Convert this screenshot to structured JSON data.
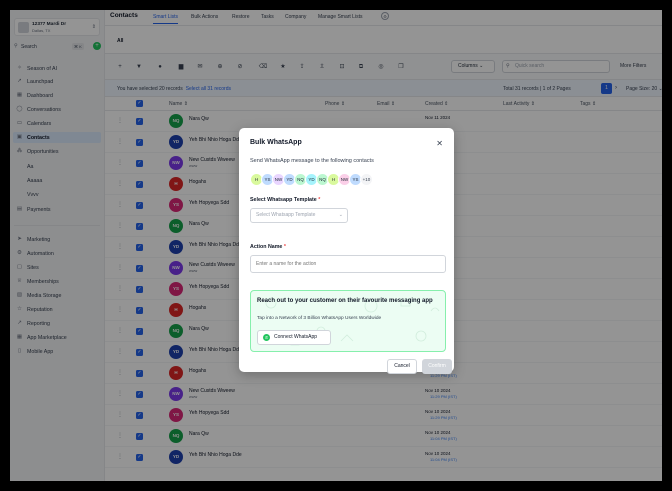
{
  "sidebar": {
    "account": {
      "name": "12377 Mardi Dr",
      "location": "Dallas, TX"
    },
    "search": {
      "label": "Search",
      "shortcut": "⌘ K"
    },
    "items": [
      {
        "label": "Season of AI",
        "icon": "sparkle-icon"
      },
      {
        "label": "Launchpad",
        "icon": "rocket-icon"
      },
      {
        "label": "Dashboard",
        "icon": "dashboard-icon"
      },
      {
        "label": "Conversations",
        "icon": "chat-icon"
      },
      {
        "label": "Calendars",
        "icon": "calendar-icon"
      },
      {
        "label": "Contacts",
        "icon": "contacts-icon"
      },
      {
        "label": "Opportunities",
        "icon": "opportunities-icon"
      },
      {
        "label": "Aa"
      },
      {
        "label": "Aaaaa"
      },
      {
        "label": "Vvvv"
      },
      {
        "label": "Payments",
        "icon": "payments-icon"
      },
      {
        "label": "Marketing",
        "icon": "marketing-icon"
      },
      {
        "label": "Automation",
        "icon": "automation-icon"
      },
      {
        "label": "Sites",
        "icon": "sites-icon"
      },
      {
        "label": "Memberships",
        "icon": "memberships-icon"
      },
      {
        "label": "Media Storage",
        "icon": "media-icon"
      },
      {
        "label": "Reputation",
        "icon": "star-icon"
      },
      {
        "label": "Reporting",
        "icon": "reporting-icon"
      },
      {
        "label": "App Marketplace",
        "icon": "marketplace-icon"
      },
      {
        "label": "Mobile App",
        "icon": "mobile-icon"
      }
    ]
  },
  "header": {
    "title": "Contacts",
    "tabs": [
      "Smart Lists",
      "Bulk Actions",
      "Restore",
      "Tasks",
      "Company",
      "Manage Smart Lists"
    ],
    "subtab": "All"
  },
  "toolbar": {
    "columns": "Columns",
    "search_placeholder": "Quick search",
    "more_filters": "More Filters"
  },
  "selection": {
    "text": "You have selected 20 records",
    "select_all": "Select all 31 records",
    "total": "Total 31 records | 1 of 2 Pages",
    "page": "1",
    "page_size": "Page Size: 20"
  },
  "table": {
    "headers": [
      "Name",
      "Phone",
      "Email",
      "Created",
      "Last Activity",
      "Tags"
    ],
    "rows": [
      {
        "initials": "NQ",
        "name": "Nara Qw",
        "color": "#16a34a",
        "created": "Nov 11 2024",
        "time": ""
      },
      {
        "initials": "YD",
        "name": "Yeh Bhi Nhio Hoga Dde",
        "color": "#1e40af",
        "created": "",
        "time": ""
      },
      {
        "initials": "NW",
        "name": "New Custds Wweew",
        "sub": "www",
        "color": "#7c3aed",
        "created": "",
        "time": ""
      },
      {
        "initials": "H",
        "name": "Hogahs",
        "color": "#dc2626",
        "created": "",
        "time": ""
      },
      {
        "initials": "YS",
        "name": "Yeh Hopyega Sdd",
        "color": "#db2777",
        "created": "",
        "time": ""
      },
      {
        "initials": "NQ",
        "name": "Nara Qw",
        "color": "#16a34a",
        "created": "",
        "time": ""
      },
      {
        "initials": "YD",
        "name": "Yeh Bhi Nhio Hoga Dde",
        "color": "#1e40af",
        "created": "",
        "time": ""
      },
      {
        "initials": "NW",
        "name": "New Custds Wweew",
        "sub": "www",
        "color": "#7c3aed",
        "created": "",
        "time": ""
      },
      {
        "initials": "YS",
        "name": "Yeh Hopyega Sdd",
        "color": "#db2777",
        "created": "",
        "time": ""
      },
      {
        "initials": "H",
        "name": "Hogahs",
        "color": "#dc2626",
        "created": "",
        "time": ""
      },
      {
        "initials": "NQ",
        "name": "Nara Qw",
        "color": "#16a34a",
        "created": "",
        "time": ""
      },
      {
        "initials": "YD",
        "name": "Yeh Bhi Nhio Hoga Dde",
        "color": "#1e40af",
        "created": "",
        "time": ""
      },
      {
        "initials": "H",
        "name": "Hogahs",
        "color": "#dc2626",
        "created": "Nov 10 2024",
        "time": "11:29 PM (IST)"
      },
      {
        "initials": "NW",
        "name": "New Custds Wweew",
        "sub": "www",
        "color": "#7c3aed",
        "created": "Nov 10 2024",
        "time": "11:29 PM (IST)"
      },
      {
        "initials": "YS",
        "name": "Yeh Hopyega Sdd",
        "color": "#db2777",
        "created": "Nov 10 2024",
        "time": "11:29 PM (IST)"
      },
      {
        "initials": "NQ",
        "name": "Nara Qw",
        "color": "#16a34a",
        "created": "Nov 10 2024",
        "time": "11:04 PM (IST)"
      },
      {
        "initials": "YD",
        "name": "Yeh Bhi Nhio Hoga Dde",
        "color": "#1e40af",
        "created": "Nov 10 2024",
        "time": "11:04 PM (IST)"
      }
    ]
  },
  "modal": {
    "title": "Bulk WhatsApp",
    "description": "Send WhatsApp message to the following contacts",
    "avatars": [
      {
        "initials": "H",
        "color": "#d9f99d"
      },
      {
        "initials": "YS",
        "color": "#bfdbfe"
      },
      {
        "initials": "NW",
        "color": "#e9d5ff"
      },
      {
        "initials": "YD",
        "color": "#bfdbfe"
      },
      {
        "initials": "NQ",
        "color": "#bbf7d0"
      },
      {
        "initials": "YD",
        "color": "#a5f3fc"
      },
      {
        "initials": "NQ",
        "color": "#bbf7d0"
      },
      {
        "initials": "H",
        "color": "#d9f99d"
      },
      {
        "initials": "NW",
        "color": "#fbcfe8"
      },
      {
        "initials": "YS",
        "color": "#bfdbfe"
      }
    ],
    "more_count": "+10",
    "template_label": "Select Whatsapp Template",
    "template_placeholder": "Select Whatsapp Template",
    "action_label": "Action Name",
    "action_placeholder": "Enter a name for the action",
    "card_title": "Reach out to your customer on their favourite messaging app",
    "card_subtitle": "Tap into a Network of 3 Billion WhatsApp Users Worldwide",
    "connect_label": "Connect WhatsApp",
    "cancel_label": "Cancel",
    "confirm_label": "Confirm"
  }
}
